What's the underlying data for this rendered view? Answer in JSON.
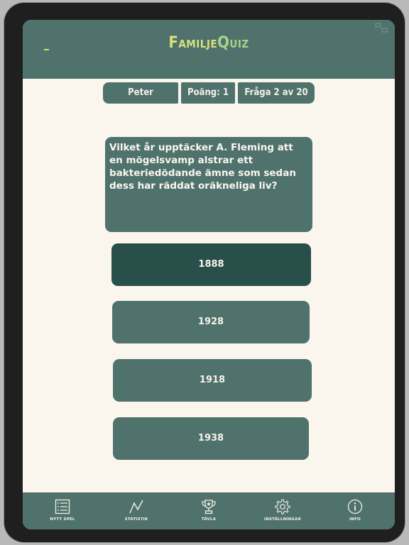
{
  "app": {
    "title_part1": "Familje",
    "title_part2": "Quiz"
  },
  "status": {
    "player": "Peter",
    "score": "Poäng: 1",
    "question_counter": "Fråga 2 av 20"
  },
  "question": {
    "text": "Vilket år upptäcker A. Fleming att en mögelsvamp alstrar ett bakteriedödande ämne som sedan dess har räddat oräkneliga liv?"
  },
  "answers": [
    {
      "label": "1888",
      "selected": true
    },
    {
      "label": "1928",
      "selected": false
    },
    {
      "label": "1918",
      "selected": false
    },
    {
      "label": "1938",
      "selected": false
    }
  ],
  "tabs": [
    {
      "label": "NYTT SPEL",
      "icon": "checklist-icon"
    },
    {
      "label": "STATISTIK",
      "icon": "line-chart-icon"
    },
    {
      "label": "TÄVLA",
      "icon": "trophy-icon"
    },
    {
      "label": "INSTÄLLNINGAR",
      "icon": "gear-icon"
    },
    {
      "label": "INFO",
      "icon": "info-icon"
    }
  ],
  "colors": {
    "primary": "#4f726d",
    "selected": "#284f49",
    "background": "#fbf6ed",
    "title_accent": "#d9e07a"
  }
}
